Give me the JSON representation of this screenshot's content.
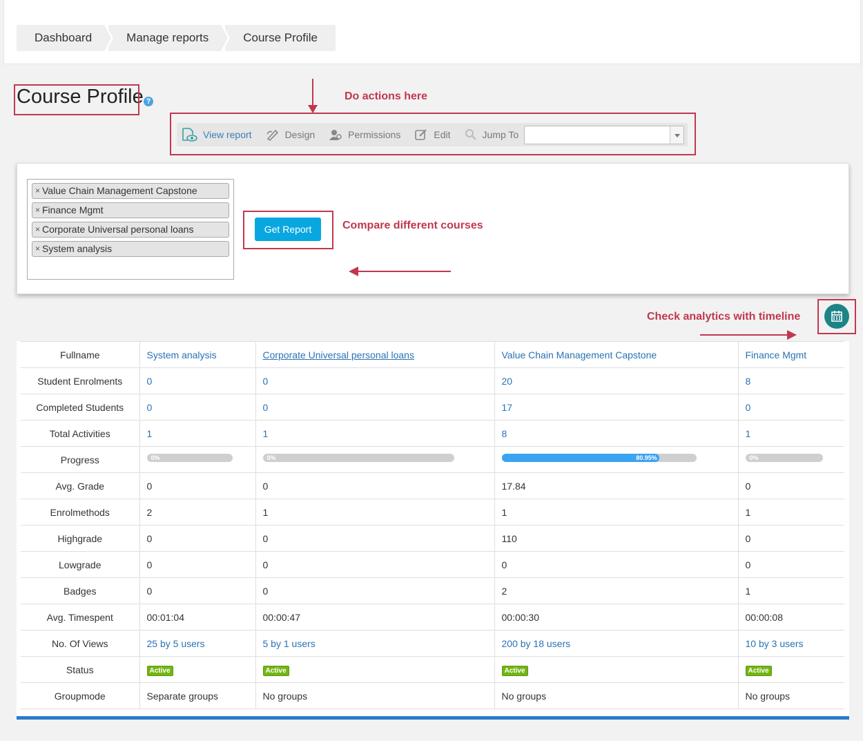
{
  "breadcrumb": {
    "items": [
      "Dashboard",
      "Manage reports",
      "Course Profile"
    ]
  },
  "page": {
    "title": "Course Profile",
    "help": "?"
  },
  "annotations": {
    "actions": "Do actions here",
    "compare": "Compare different courses",
    "timeline": "Check analytics with timeline",
    "color": "#c1374f"
  },
  "toolbar": {
    "view_report": "View report",
    "design": "Design",
    "permissions": "Permissions",
    "edit": "Edit",
    "jump_to": "Jump To",
    "jump_value": ""
  },
  "filter": {
    "selected_courses": [
      "Value Chain Management Capstone",
      "Finance Mgmt",
      "Corporate Universal personal loans",
      "System analysis"
    ],
    "remove_symbol": "×",
    "get_report_label": "Get Report",
    "accent_color": "#08a7e0"
  },
  "table": {
    "rows": {
      "fullname": "Fullname",
      "enrolments": "Student Enrolments",
      "completed": "Completed Students",
      "activities": "Total Activities",
      "progress": "Progress",
      "avg_grade": "Avg. Grade",
      "enrolmethods": "Enrolmethods",
      "highgrade": "Highgrade",
      "lowgrade": "Lowgrade",
      "badges": "Badges",
      "timespent": "Avg. Timespent",
      "views": "No. Of Views",
      "status": "Status",
      "groupmode": "Groupmode"
    },
    "courses": [
      {
        "name": "System analysis",
        "enrolments": "0",
        "completed": "0",
        "activities": "1",
        "progress": 0,
        "progress_label": "0%",
        "avg_grade": "0",
        "enrolmethods": "2",
        "highgrade": "0",
        "lowgrade": "0",
        "badges": "0",
        "timespent": "00:01:04",
        "views": "25 by 5 users",
        "status": "Active",
        "groupmode": "Separate groups"
      },
      {
        "name": "Corporate Universal personal loans",
        "enrolments": "0",
        "completed": "0",
        "activities": "1",
        "progress": 0,
        "progress_label": "0%",
        "avg_grade": "0",
        "enrolmethods": "1",
        "highgrade": "0",
        "lowgrade": "0",
        "badges": "0",
        "timespent": "00:00:47",
        "views": "5 by 1 users",
        "status": "Active",
        "groupmode": "No groups"
      },
      {
        "name": "Value Chain Management Capstone",
        "enrolments": "20",
        "completed": "17",
        "activities": "8",
        "progress": 80.95,
        "progress_label": "80.95%",
        "avg_grade": "17.84",
        "enrolmethods": "1",
        "highgrade": "110",
        "lowgrade": "0",
        "badges": "2",
        "timespent": "00:00:30",
        "views": "200 by 18 users",
        "status": "Active",
        "groupmode": "No groups"
      },
      {
        "name": "Finance Mgmt",
        "enrolments": "8",
        "completed": "0",
        "activities": "1",
        "progress": 0,
        "progress_label": "0%",
        "avg_grade": "0",
        "enrolmethods": "1",
        "highgrade": "0",
        "lowgrade": "0",
        "badges": "1",
        "timespent": "00:00:08",
        "views": "10 by 3 users",
        "status": "Active",
        "groupmode": "No groups"
      }
    ]
  }
}
